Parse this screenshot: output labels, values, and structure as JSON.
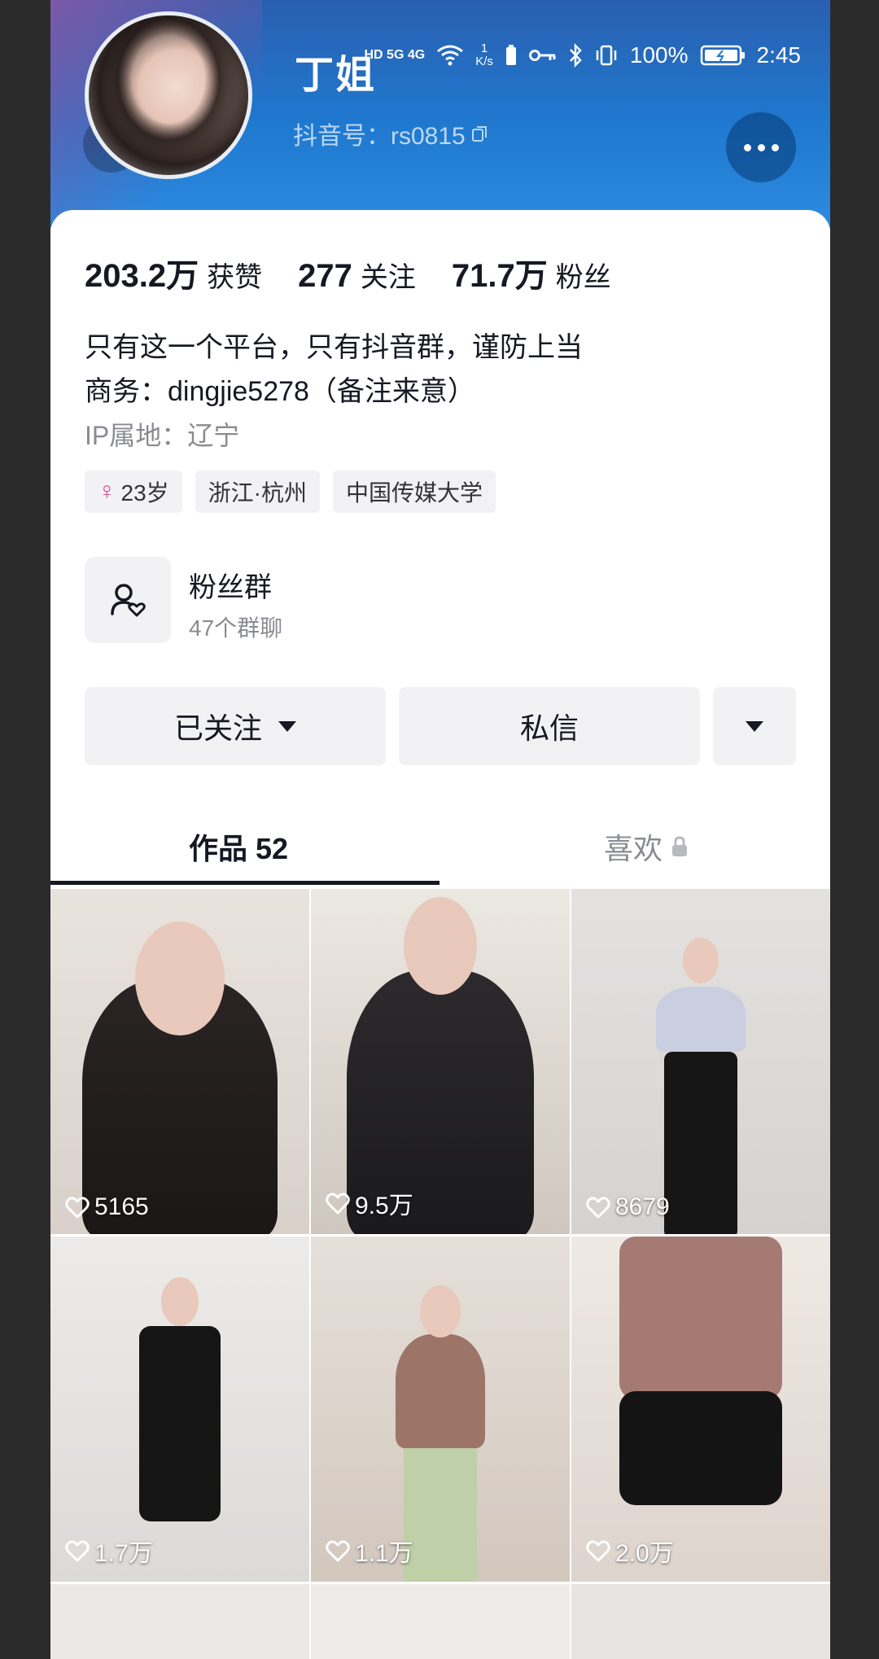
{
  "status_bar": {
    "network": "HD 5G 4G",
    "speed_value": "1",
    "speed_unit": "K/s",
    "battery": "100%",
    "time": "2:45"
  },
  "profile": {
    "name": "丁姐",
    "douyin_id": "抖音号：rs0815"
  },
  "stats": [
    {
      "value": "203.2万",
      "label": "获赞"
    },
    {
      "value": "277",
      "label": "关注"
    },
    {
      "value": "71.7万",
      "label": "粉丝"
    }
  ],
  "bio": {
    "line1": "只有这一个平台，只有抖音群，谨防上当",
    "line2": "商务：dingjie5278（备注来意）"
  },
  "ip_location": "IP属地：辽宁",
  "tags": {
    "age": "23岁",
    "location": "浙江·杭州",
    "school": "中国传媒大学"
  },
  "fan_group": {
    "title": "粉丝群",
    "subtitle": "47个群聊"
  },
  "actions": {
    "follow_label": "已关注",
    "message_label": "私信"
  },
  "tabs": {
    "works": "作品 52",
    "likes": "喜欢"
  },
  "videos": [
    {
      "likes": "5165"
    },
    {
      "likes": "9.5万"
    },
    {
      "likes": "8679"
    },
    {
      "likes": "1.7万"
    },
    {
      "likes": "1.1万"
    },
    {
      "likes": "2.0万"
    }
  ],
  "colors": {
    "header_blue": "#1f79cf",
    "text_primary": "#161823",
    "text_secondary": "#8a8b91",
    "button_bg": "#f2f2f4",
    "female_pink": "#e0449b"
  }
}
